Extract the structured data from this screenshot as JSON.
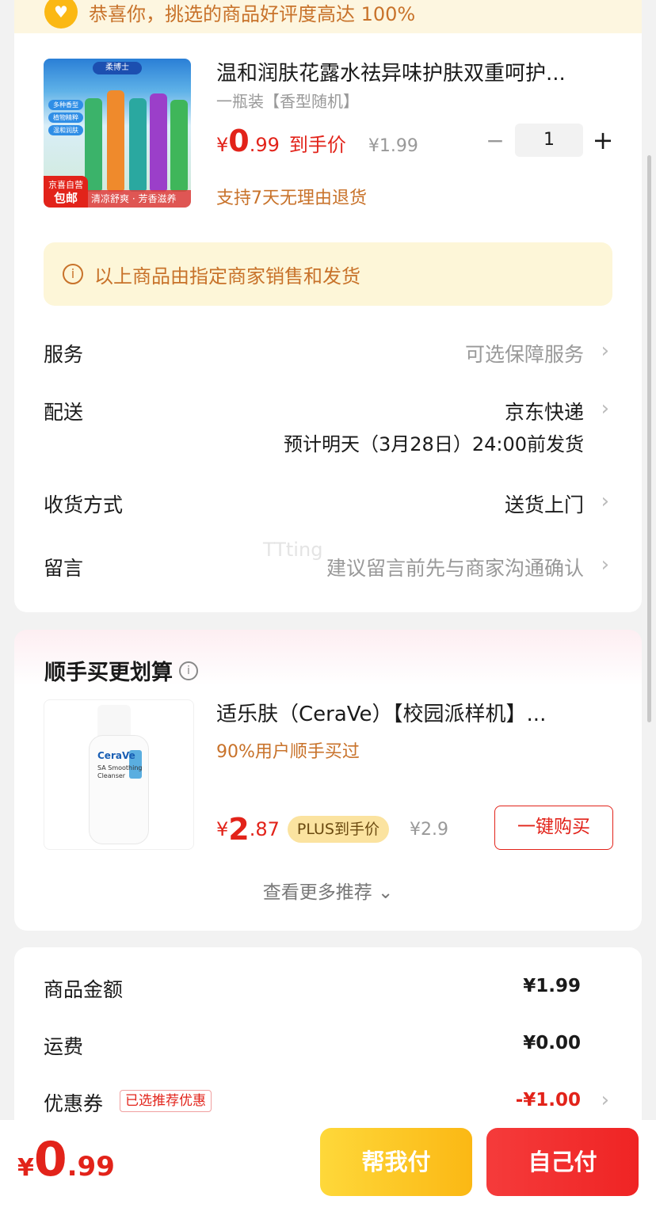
{
  "banner": {
    "text": "恭喜你，挑选的商品好评度高达 100%"
  },
  "product": {
    "image_tag_top": "京喜自营",
    "image_tag_bottom": "包邮",
    "image_caption": "清凉舒爽 · 芳香滋养",
    "image_brand": "柔博士",
    "image_pills": [
      "多种香型",
      "植物精粹",
      "温和润肤"
    ],
    "title": "温和润肤花露水祛异味护肤双重呵护...",
    "spec": "一瓶装【香型随机】",
    "price_currency": "¥",
    "price_int": "0",
    "price_dec": ".99",
    "price_label": "到手价",
    "original_price": "¥1.99",
    "quantity": "1",
    "minus": "−",
    "plus": "+",
    "return_policy": "支持7天无理由退货"
  },
  "notice": {
    "icon": "i",
    "text": "以上商品由指定商家销售和发货"
  },
  "rows": {
    "service_label": "服务",
    "service_value": "可选保障服务",
    "delivery_label": "配送",
    "delivery_value": "京东快递",
    "delivery_estimate": "预计明天（3月28日）24:00前发货",
    "receive_label": "收货方式",
    "receive_value": "送货上门",
    "message_label": "留言",
    "message_value": "建议留言前先与商家沟通确认",
    "chevron": "›",
    "watermark": "TTting"
  },
  "recommend": {
    "title": "顺手买更划算",
    "info_icon": "i",
    "item_name": "适乐肤（CeraVe）【校园派样机】...",
    "image_brand": "CeraVe",
    "image_line": "SA Smoothing Cleanser",
    "bought_ratio": "90%用户顺手买过",
    "price_currency": "¥",
    "price_int": "2",
    "price_dec": ".87",
    "plus_badge": "PLUS到手价",
    "original_price": "¥2.9",
    "buy_button": "一键购买",
    "more": "查看更多推荐 ⌄"
  },
  "summary": {
    "goods_label": "商品金额",
    "goods_amount": "¥1.99",
    "shipping_label": "运费",
    "shipping_amount": "¥0.00",
    "coupon_label": "优惠券",
    "coupon_badge": "已选推荐优惠",
    "coupon_amount": "-¥1.00",
    "chevron": "›"
  },
  "footer": {
    "total_currency": "¥",
    "total_int": "0",
    "total_dec": ".99",
    "pay_friend": "帮我付",
    "pay_self": "自己付"
  },
  "colors": {
    "accent_red": "#e2231a",
    "accent_orange": "#c8722a",
    "yellow_button": "#fbb814",
    "red_button": "#ef2424"
  }
}
